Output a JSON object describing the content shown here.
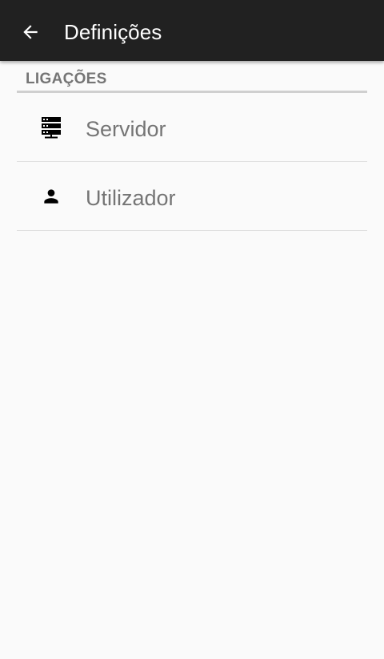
{
  "app_bar": {
    "title": "Definições",
    "back_icon": "arrow-back-icon",
    "background": "#212121",
    "text_color": "#ffffff"
  },
  "section": {
    "title": "LIGAÇÕES",
    "items": [
      {
        "label": "Servidor",
        "icon": "server-icon"
      },
      {
        "label": "Utilizador",
        "icon": "person-icon"
      }
    ]
  },
  "colors": {
    "background": "#fafafa",
    "secondary_text": "#757575",
    "icon": "#000000"
  }
}
